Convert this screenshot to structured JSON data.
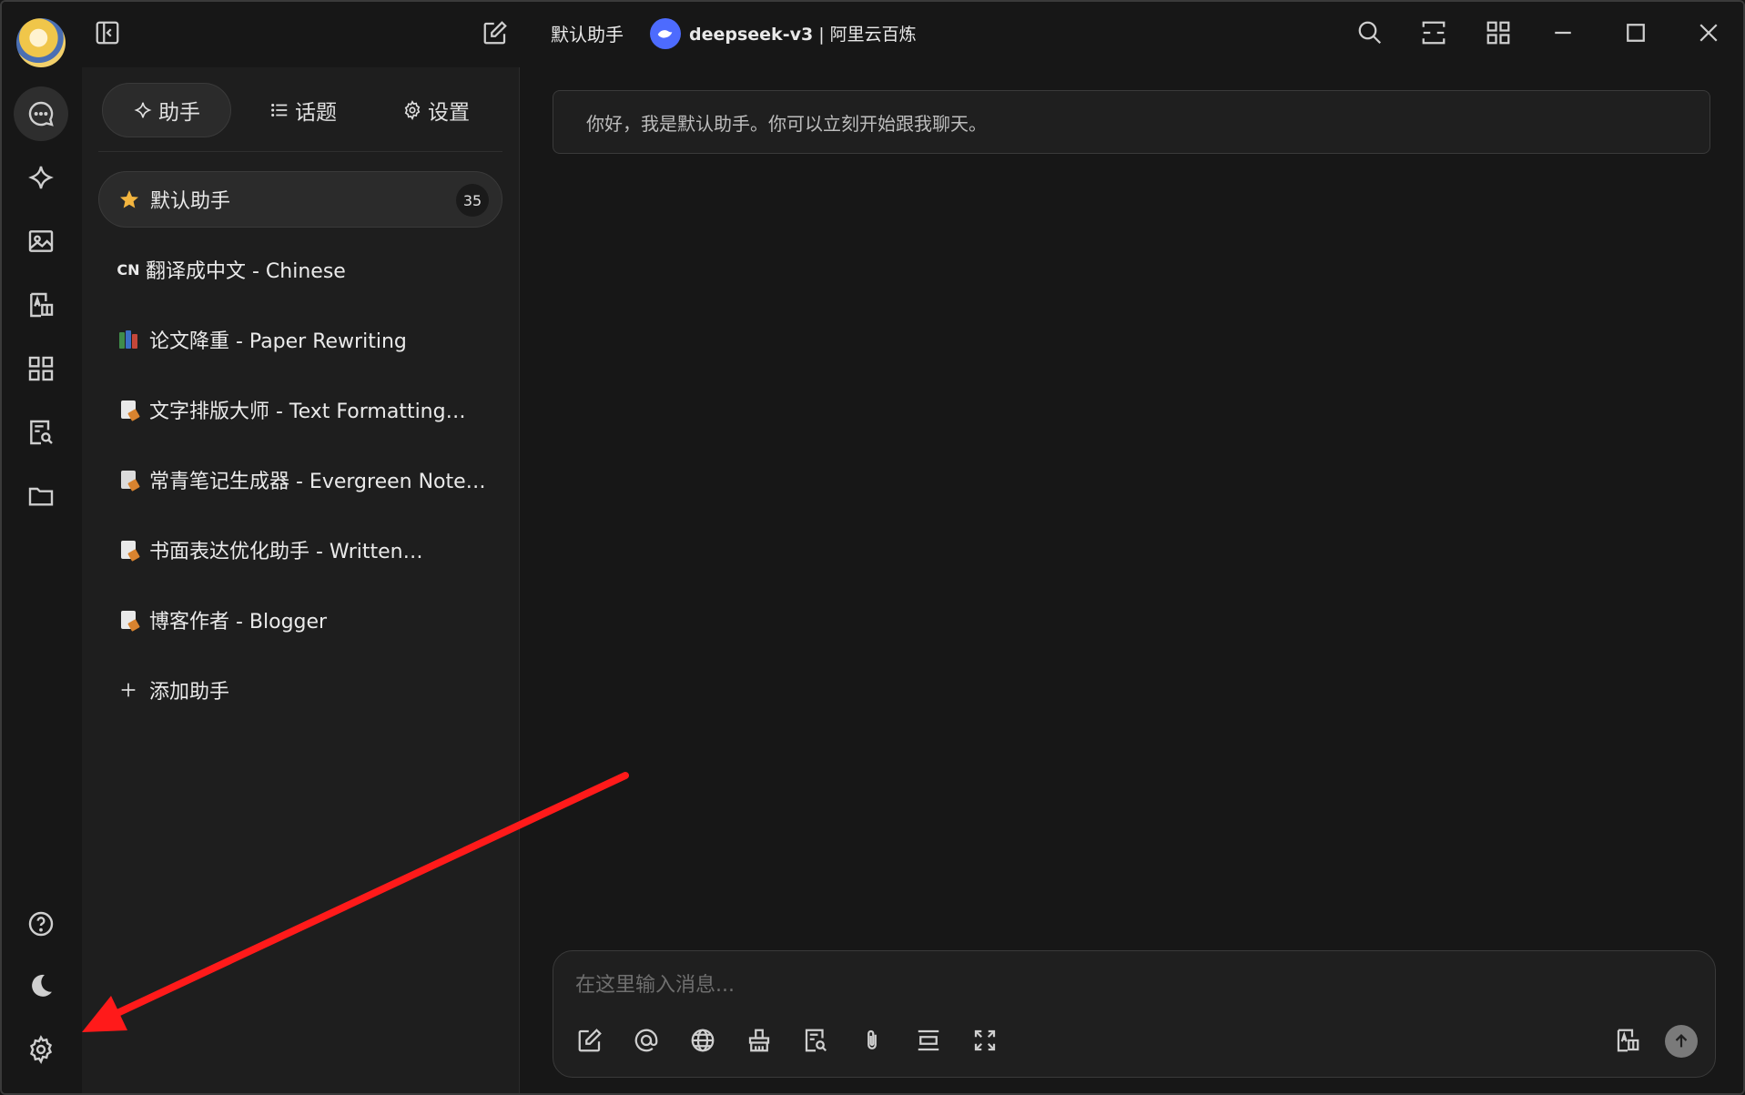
{
  "titlebar": {
    "assistant_name": "默认助手",
    "model_name": "deepseek-v3",
    "separator": " | ",
    "provider": "阿里云百炼",
    "icons": [
      "sidebar-toggle-icon",
      "new-topic-icon",
      "search-icon",
      "expand-horizontal-icon",
      "grid-icon",
      "minimize-icon",
      "maximize-icon",
      "close-icon"
    ]
  },
  "rail": {
    "top_icons": [
      "chat-bubble-icon",
      "sparkle-icon",
      "image-icon",
      "translate-icon",
      "apps-grid-icon",
      "knowledge-search-icon",
      "folder-icon"
    ],
    "bottom_icons": [
      "help-icon",
      "moon-icon",
      "settings-gear-icon"
    ]
  },
  "panel": {
    "tabs": [
      {
        "label": "助手",
        "icon": "sparkle-icon"
      },
      {
        "label": "话题",
        "icon": "list-icon"
      },
      {
        "label": "设置",
        "icon": "gear-icon"
      }
    ],
    "assistants": [
      {
        "label": "默认助手",
        "emoji": "star",
        "count": "35"
      },
      {
        "label": "翻译成中文 - Chinese",
        "emoji_text": "CN"
      },
      {
        "label": "论文降重 - Paper Rewriting",
        "emoji": "books"
      },
      {
        "label": "文字排版大师 - Text Formatting…",
        "emoji": "memo"
      },
      {
        "label": "常青笔记生成器 - Evergreen Note…",
        "emoji": "page"
      },
      {
        "label": "书面表达优化助手 - Written…",
        "emoji": "memo"
      },
      {
        "label": "博客作者 - Blogger",
        "emoji": "memo"
      }
    ],
    "add_label": "添加助手"
  },
  "main": {
    "greeting": "你好，我是默认助手。你可以立刻开始跟我聊天。",
    "input_placeholder": "在这里输入消息...",
    "toolbar_icons": [
      "new-topic-icon",
      "mention-icon",
      "globe-icon",
      "clear-icon",
      "knowledge-icon",
      "attachment-icon",
      "divider-icon",
      "fullscreen-icon",
      "translate-icon",
      "send-icon"
    ]
  },
  "colors": {
    "background": "#171717",
    "panel": "#1e1e1e",
    "accent_model": "#4d6bfe",
    "annotation_arrow": "#ff1a1a"
  }
}
